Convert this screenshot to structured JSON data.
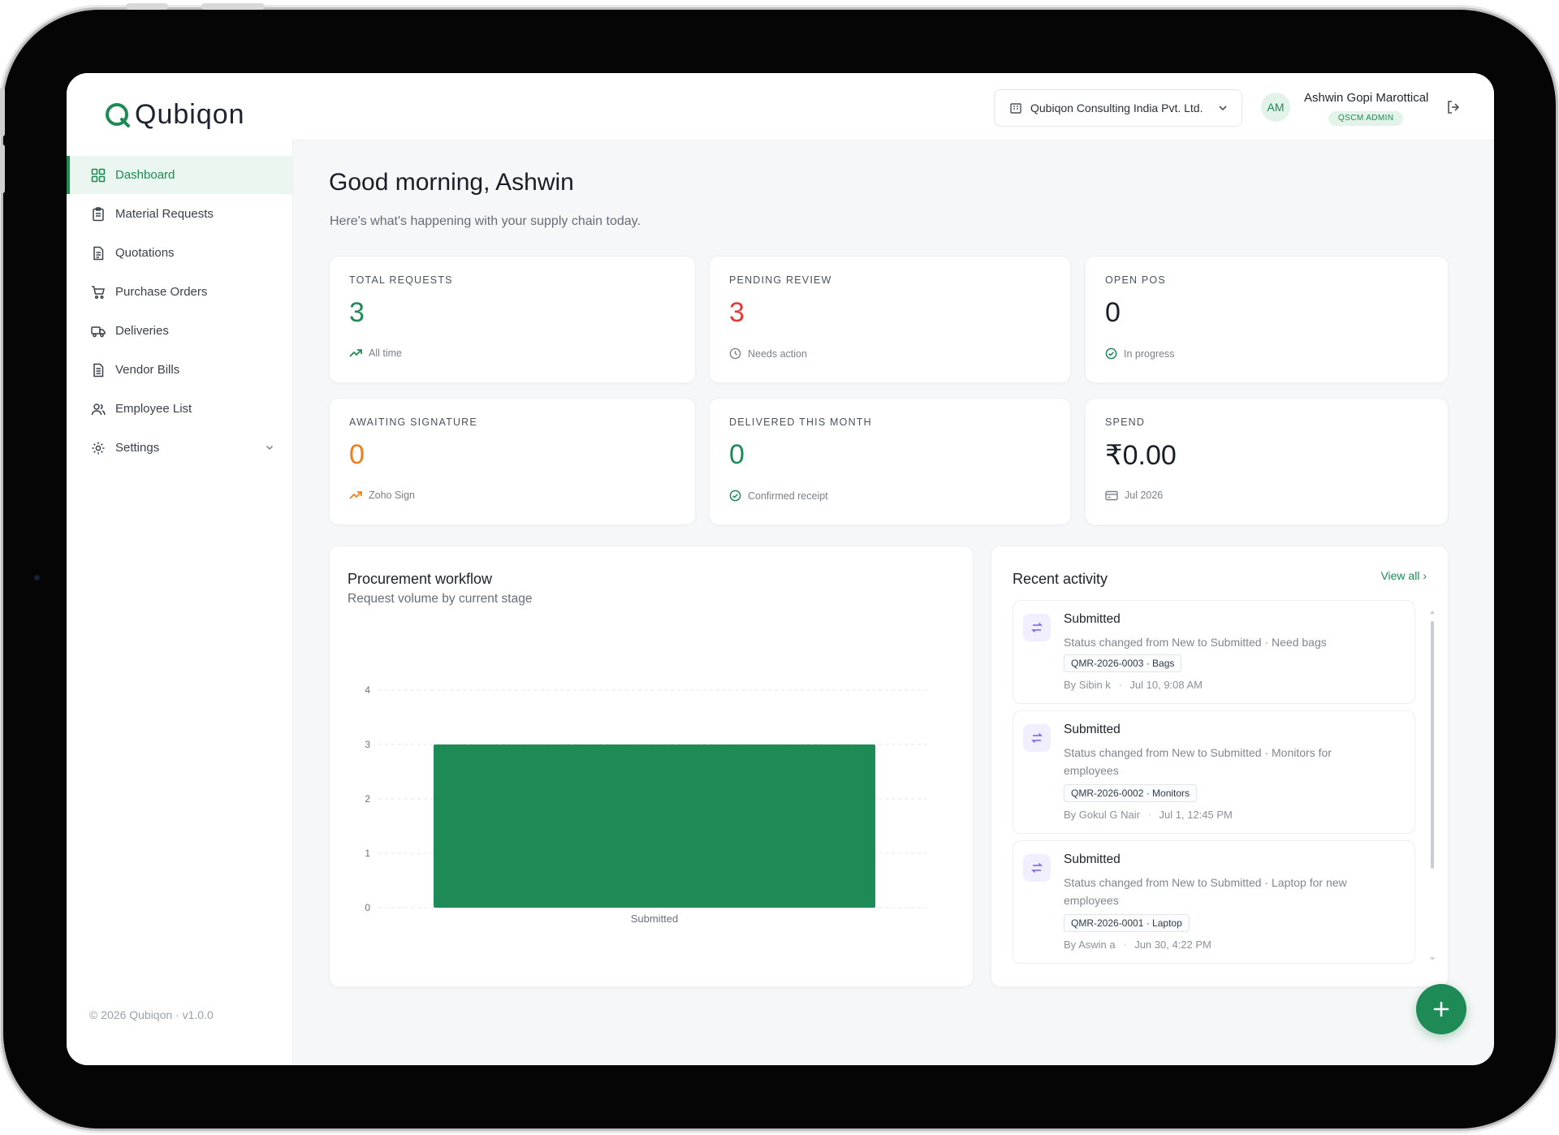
{
  "brand": {
    "name": "Qubiqon",
    "accent": "#1e8a55"
  },
  "sidebar": {
    "items": [
      {
        "label": "Dashboard",
        "icon": "dashboard-icon",
        "active": true
      },
      {
        "label": "Material Requests",
        "icon": "clipboard-icon"
      },
      {
        "label": "Quotations",
        "icon": "document-icon"
      },
      {
        "label": "Purchase Orders",
        "icon": "cart-icon"
      },
      {
        "label": "Deliveries",
        "icon": "truck-icon"
      },
      {
        "label": "Vendor Bills",
        "icon": "bill-icon"
      },
      {
        "label": "Employee List",
        "icon": "users-icon"
      },
      {
        "label": "Settings",
        "icon": "gear-icon"
      }
    ],
    "footer": "© 2026 Qubiqon · v1.0.0"
  },
  "header": {
    "org": "Qubiqon Consulting India Pvt. Ltd.",
    "user_initials": "AM",
    "user_name": "Ashwin Gopi Marottical",
    "user_role": "QSCM ADMIN"
  },
  "main": {
    "greeting": "Good morning, Ashwin",
    "subtitle": "Here's what's happening with your supply chain today."
  },
  "stats": [
    {
      "label": "TOTAL REQUESTS",
      "value": "3",
      "note": "All time",
      "color": "#1e8a55"
    },
    {
      "label": "PENDING REVIEW",
      "value": "3",
      "note": "Needs action",
      "color": "#e03b3b"
    },
    {
      "label": "OPEN POS",
      "value": "0",
      "note": "In progress",
      "color": "#1a1f27"
    },
    {
      "label": "AWAITING SIGNATURE",
      "value": "0",
      "note": "Zoho Sign",
      "color": "#ef7d1a"
    },
    {
      "label": "DELIVERED THIS MONTH",
      "value": "0",
      "note": "Confirmed receipt",
      "color": "#1e8a55"
    },
    {
      "label": "SPEND",
      "value": "₹0.00",
      "note": "Jul 2026",
      "color": "#1a1f27"
    }
  ],
  "workflow": {
    "title": "Procurement workflow",
    "subtitle": "Request volume by current stage"
  },
  "chart_data": {
    "type": "bar",
    "categories": [
      "Submitted"
    ],
    "values": [
      3
    ],
    "ylim": [
      0,
      4
    ],
    "yticks": [
      "0",
      "1",
      "2",
      "3",
      "4"
    ],
    "grid": true,
    "color": "#1e8a55"
  },
  "activity": {
    "title": "Recent activity",
    "view_all": "View all ›",
    "items": [
      {
        "title": "Submitted",
        "desc": "Status changed from New to Submitted · Need bags",
        "tag": "QMR-2026-0003 · Bags",
        "by": "By Sibin k",
        "time": "Jul 10, 9:08 AM"
      },
      {
        "title": "Submitted",
        "desc": "Status changed from New to Submitted · Monitors for employees",
        "tag": "QMR-2026-0002 · Monitors",
        "by": "By Gokul G Nair",
        "time": "Jul 1, 12:45 PM"
      },
      {
        "title": "Submitted",
        "desc": "Status changed from New to Submitted · Laptop for new employees",
        "tag": "QMR-2026-0001 · Laptop",
        "by": "By Aswin a",
        "time": "Jun 30, 4:22 PM"
      }
    ]
  }
}
